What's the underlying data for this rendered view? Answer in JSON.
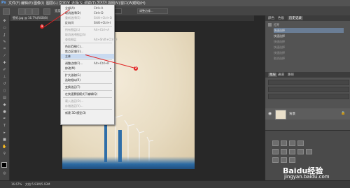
{
  "menubar": {
    "items": [
      "文件(F)",
      "编辑(E)",
      "图像(I)",
      "图层(L)",
      "文字(Y)",
      "选择(S)",
      "滤镜(T)",
      "3D(D)",
      "视图(V)",
      "窗口(W)",
      "帮助(H)"
    ],
    "active_index": 5
  },
  "options": {
    "width_label": "宽度：",
    "height_label": "高度：",
    "refine_button": "调整边缘..."
  },
  "document_tab": "壁纸.jpg @ 16.7%(RGB/8)",
  "select_menu": {
    "items": [
      {
        "label": "全部(A)",
        "shortcut": "Ctrl+A",
        "disabled": false
      },
      {
        "label": "取消选择(D)",
        "shortcut": "Ctrl+D",
        "disabled": false
      },
      {
        "label": "重新选择(E)",
        "shortcut": "Shift+Ctrl+D",
        "disabled": true
      },
      {
        "label": "反向(I)",
        "shortcut": "Shift+Ctrl+I",
        "disabled": false
      },
      {
        "sep": true
      },
      {
        "label": "所有图层(L)",
        "shortcut": "Alt+Ctrl+A",
        "disabled": true
      },
      {
        "label": "取消选择图层(S)",
        "shortcut": "",
        "disabled": true
      },
      {
        "label": "查找图层",
        "shortcut": "Alt+Shift+Ctrl+F",
        "disabled": true
      },
      {
        "sep": true
      },
      {
        "label": "色彩范围(C)...",
        "shortcut": "",
        "disabled": false
      },
      {
        "label": "焦点区域(U)...",
        "shortcut": "",
        "disabled": false
      },
      {
        "label": "主体",
        "shortcut": "",
        "disabled": false,
        "highlight": true
      },
      {
        "sep": true
      },
      {
        "label": "调整边缘(F)...",
        "shortcut": "Alt+Ctrl+R",
        "disabled": false
      },
      {
        "label": "修改(M)",
        "shortcut": "",
        "disabled": false
      },
      {
        "sep": true
      },
      {
        "label": "扩大选取(G)",
        "shortcut": "",
        "disabled": false
      },
      {
        "label": "选取相似(R)",
        "shortcut": "",
        "disabled": false
      },
      {
        "sep": true
      },
      {
        "label": "变换选区(T)",
        "shortcut": "",
        "disabled": false
      },
      {
        "sep": true
      },
      {
        "label": "在快速蒙版模式下编辑(Q)",
        "shortcut": "",
        "disabled": false
      },
      {
        "sep": true
      },
      {
        "label": "载入选区(O)...",
        "shortcut": "",
        "disabled": true
      },
      {
        "label": "存储选区(V)...",
        "shortcut": "",
        "disabled": true
      },
      {
        "sep": true
      },
      {
        "label": "新建 3D 模型(3)",
        "shortcut": "",
        "disabled": false
      }
    ]
  },
  "annotations": {
    "marker1": "1",
    "marker2": "2"
  },
  "right_panel": {
    "tabs": [
      "颜色",
      "色板",
      "历史记录"
    ],
    "active_tab_index": 2,
    "history": [
      {
        "label": "打开",
        "dim": false
      },
      {
        "label": "快速选择",
        "dim": false
      },
      {
        "label": "快速选择",
        "dim": false
      },
      {
        "label": "快速选择",
        "dim": true
      },
      {
        "label": "快速选择",
        "dim": true
      },
      {
        "label": "快速选择",
        "dim": true
      },
      {
        "label": "取消选择",
        "dim": true
      }
    ],
    "layers_tabs": [
      "图层",
      "通道",
      "路径"
    ],
    "layer_name": "背景"
  },
  "status": {
    "zoom": "16.67%",
    "doc_size": "文档:5.93M/5.93M"
  },
  "watermark": {
    "logo": "Baidu经验",
    "url": "jingyan.baidu.com"
  },
  "colors": {
    "accent_red": "#e02020",
    "menu_highlight": "#c9daf0"
  }
}
